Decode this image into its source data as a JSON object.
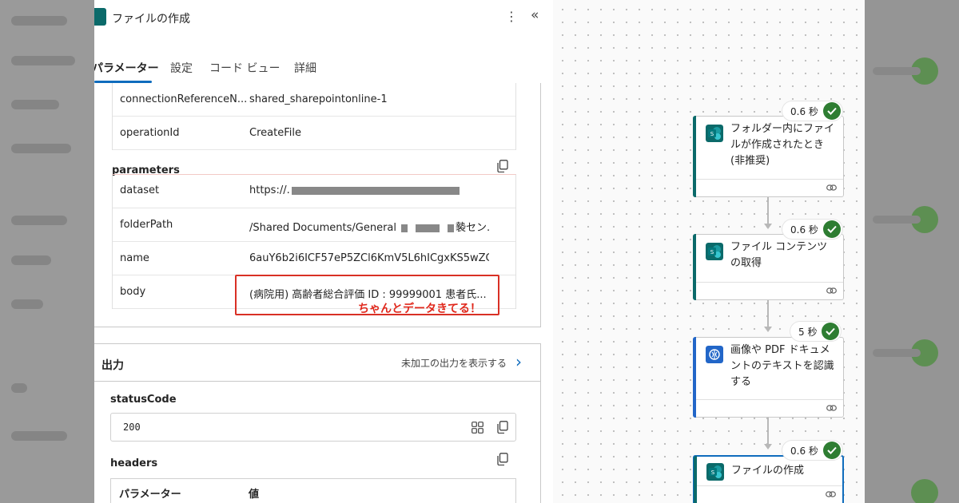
{
  "panel": {
    "title": "ファイルの作成",
    "more_icon": "more-vertical-icon",
    "collapse_icon": "double-chevron-left-icon"
  },
  "tabs": [
    "パラメーター",
    "設定",
    "コード ビュー",
    "詳細"
  ],
  "inputs_top": [
    {
      "key": "connectionReferenceN...",
      "value": "shared_sharepointonline-1"
    },
    {
      "key": "operationId",
      "value": "CreateFile"
    }
  ],
  "parameters": {
    "label": "parameters",
    "rows": [
      {
        "key": "dataset",
        "value": "https://."
      },
      {
        "key": "folderPath",
        "value": "/Shared Documents/General",
        "value_tail": "褺セン..."
      },
      {
        "key": "name",
        "value": "6auY6b2i6ICF57eP5ZCl6KmV5L6hICgxKS5wZG..."
      },
      {
        "key": "body",
        "value": "(病院用) 高齢者総合評価 ID : 99999001 患者氏..."
      }
    ],
    "annotation": "ちゃんとデータきてる！"
  },
  "output": {
    "title": "出力",
    "raw_link": "未加工の出力を表示する",
    "status_label": "statusCode",
    "status_value": "200",
    "headers_label": "headers",
    "headers_columns": [
      "パラメーター",
      "値"
    ]
  },
  "flow": [
    {
      "label": "フォルダー内にファイルが作成されたとき (非推奨)",
      "duration": "0.6 秒",
      "icon": "sharepoint-icon",
      "accent": "#0b6a6a",
      "status": "success"
    },
    {
      "label": "ファイル コンテンツの取得",
      "duration": "0.6 秒",
      "icon": "sharepoint-icon",
      "accent": "#0b6a6a",
      "status": "success"
    },
    {
      "label": "画像や PDF ドキュメントのテキストを認識する",
      "duration": "5 秒",
      "icon": "ai-builder-icon",
      "accent": "#2266c8",
      "status": "success"
    },
    {
      "label": "ファイルの作成",
      "duration": "0.6 秒",
      "icon": "sharepoint-icon",
      "accent": "#0b6a6a",
      "status": "success"
    }
  ],
  "colors": {
    "accent_blue": "#0f6cbd",
    "success_green": "#2e7d32",
    "highlight_red": "#d93025"
  }
}
